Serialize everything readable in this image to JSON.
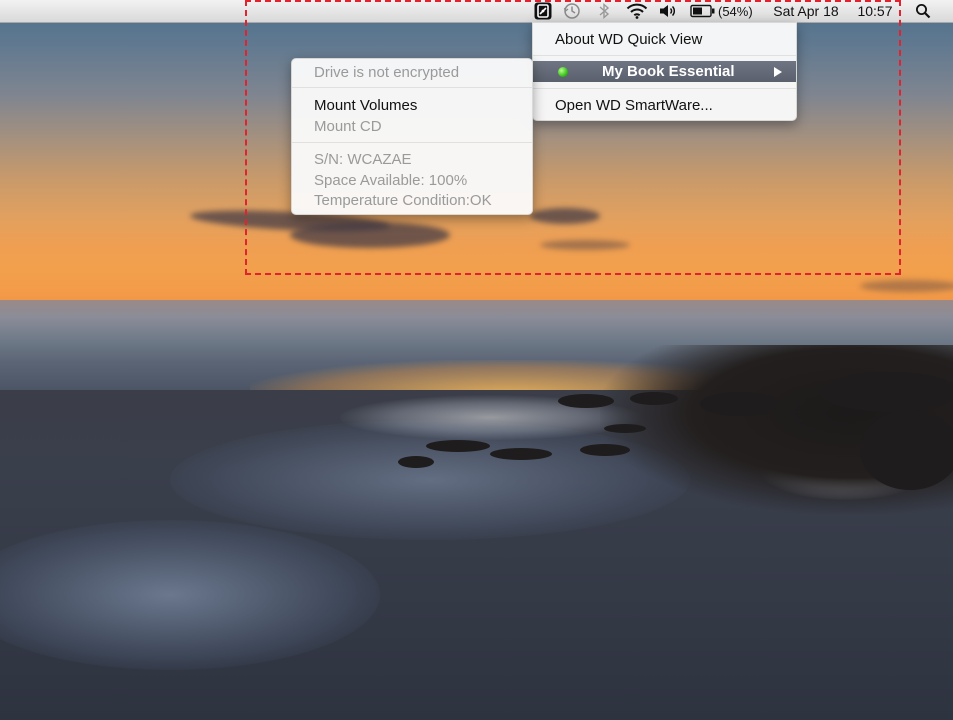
{
  "menubar": {
    "battery_percent": "(54%)",
    "date": "Sat Apr 18",
    "time": "10:57",
    "icons": [
      "wd-quick-view-icon",
      "time-machine-icon",
      "bluetooth-icon",
      "wifi-icon",
      "volume-icon",
      "battery-icon",
      "spotlight-search-icon"
    ]
  },
  "quick_view_menu": {
    "items": [
      {
        "label": "About WD Quick View",
        "enabled": true
      },
      {
        "label": "My Book Essential",
        "enabled": true,
        "selected": true,
        "has_submenu": true,
        "status_color": "#38c21a"
      },
      {
        "label": "Open WD SmartWare...",
        "enabled": true
      }
    ]
  },
  "drive_submenu": {
    "encryption_status": "Drive is not encrypted",
    "mount_volumes": "Mount Volumes",
    "mount_cd": "Mount CD",
    "serial_number": "S/N: WCAZAE",
    "space_available": "Space Available: 100%",
    "temperature": "Temperature Condition:OK"
  },
  "colors": {
    "highlight": "#e2232f",
    "selected_item": "#5a606c"
  }
}
